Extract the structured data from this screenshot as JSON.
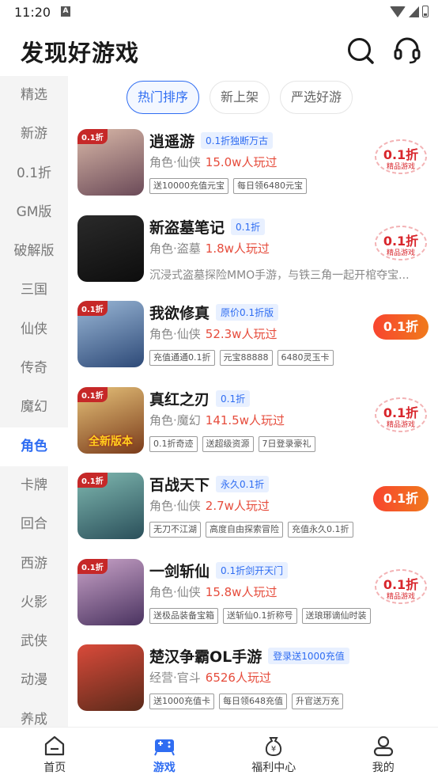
{
  "status_bar": {
    "time": "11:20",
    "notification_letter": "A"
  },
  "header": {
    "title": "发现好游戏",
    "search_icon": "search-icon",
    "service_icon": "headset-icon"
  },
  "sidebar": {
    "items": [
      {
        "label": "精选"
      },
      {
        "label": "新游"
      },
      {
        "label": "0.1折"
      },
      {
        "label": "GM版"
      },
      {
        "label": "破解版"
      },
      {
        "label": "三国"
      },
      {
        "label": "仙侠"
      },
      {
        "label": "传奇"
      },
      {
        "label": "魔幻"
      },
      {
        "label": "角色",
        "active": true
      },
      {
        "label": "卡牌"
      },
      {
        "label": "回合"
      },
      {
        "label": "西游"
      },
      {
        "label": "火影"
      },
      {
        "label": "武侠"
      },
      {
        "label": "动漫"
      },
      {
        "label": "养成"
      }
    ]
  },
  "tabs": [
    {
      "label": "热门排序",
      "active": true
    },
    {
      "label": "新上架"
    },
    {
      "label": "严选好游"
    }
  ],
  "games": [
    {
      "name": "逍遥游",
      "badge": "0.1折独断万古",
      "icon_tag": "0.1折",
      "category": "角色·仙侠",
      "players": "15.0w人玩过",
      "chips": [
        "送10000充值元宝",
        "每日领6480元宝"
      ],
      "action": {
        "type": "stamp",
        "main": "0.1折",
        "sub": "精品游戏"
      },
      "colors": [
        "#d9b8a8",
        "#6b4a58"
      ]
    },
    {
      "name": "新盗墓笔记",
      "badge": "0.1折",
      "icon_tag": "",
      "category": "角色·盗墓",
      "players": "1.8w人玩过",
      "description": "沉浸式盗墓探险MMO手游，与铁三角一起开棺夺宝...",
      "action": {
        "type": "stamp",
        "main": "0.1折",
        "sub": "精品游戏"
      },
      "colors": [
        "#2a2a2a",
        "#0d0d0d"
      ]
    },
    {
      "name": "我欲修真",
      "badge": "原价0.1折版",
      "icon_tag": "0.1折",
      "category": "角色·仙侠",
      "players": "52.3w人玩过",
      "chips": [
        "充值通通0.1折",
        "元宝88888",
        "6480灵玉卡"
      ],
      "action": {
        "type": "button",
        "main": "0.1折"
      },
      "colors": [
        "#9ab7d6",
        "#2e4a78"
      ]
    },
    {
      "name": "真红之刃",
      "badge": "0.1折",
      "icon_tag": "0.1折",
      "category": "角色·魔幻",
      "players": "141.5w人玩过",
      "chips": [
        "0.1折奇迹",
        "送超级资源",
        "7日登录豪礼"
      ],
      "action": {
        "type": "stamp",
        "main": "0.1折",
        "sub": "精品游戏"
      },
      "colors": [
        "#e6c27a",
        "#7a3b1a"
      ],
      "icon_caption": "全新版本"
    },
    {
      "name": "百战天下",
      "badge": "永久0.1折",
      "icon_tag": "0.1折",
      "category": "角色·仙侠",
      "players": "2.7w人玩过",
      "chips": [
        "无刀不江湖",
        "高度自由探索冒险",
        "充值永久0.1折"
      ],
      "action": {
        "type": "button",
        "main": "0.1折"
      },
      "colors": [
        "#7fb8b0",
        "#2a4f5a"
      ]
    },
    {
      "name": "一剑斩仙",
      "badge": "0.1折剑开天门",
      "icon_tag": "0.1折",
      "category": "角色·仙侠",
      "players": "15.8w人玩过",
      "chips": [
        "送极品装备宝箱",
        "送斩仙0.1折称号",
        "送琅琊谪仙时装"
      ],
      "action": {
        "type": "stamp",
        "main": "0.1折",
        "sub": "精品游戏"
      },
      "colors": [
        "#c9a3c8",
        "#4a3360"
      ]
    },
    {
      "name": "楚汉争霸OL手游",
      "badge": "登录送1000充值",
      "icon_tag": "",
      "category": "经营·官斗",
      "players": "6526人玩过",
      "chips": [
        "送1000充值卡",
        "每日领648充值",
        "升官送万充"
      ],
      "action": {
        "type": "none"
      },
      "colors": [
        "#d94a3a",
        "#5a2a1a"
      ]
    }
  ],
  "bottom_nav": [
    {
      "label": "首页",
      "icon": "home-icon"
    },
    {
      "label": "游戏",
      "icon": "gamepad-icon",
      "active": true
    },
    {
      "label": "福利中心",
      "icon": "money-bag-icon"
    },
    {
      "label": "我的",
      "icon": "profile-icon"
    }
  ],
  "colors": {
    "accent": "#2f6df2",
    "price_red": "#e64c3c",
    "stamp_red": "#d8262c"
  }
}
